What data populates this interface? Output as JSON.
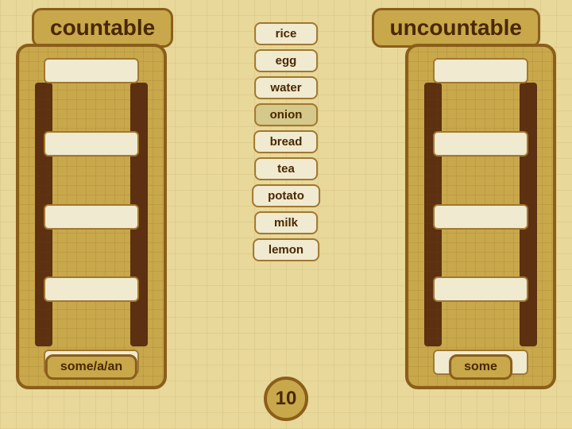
{
  "header": {
    "left_label": "countable",
    "right_label": "uncountable"
  },
  "left_ladder": {
    "rungs": 5,
    "bottom_label": "some/a/an"
  },
  "right_ladder": {
    "rungs": 5,
    "bottom_label": "some"
  },
  "words": [
    {
      "id": "rice",
      "label": "rice"
    },
    {
      "id": "egg",
      "label": "egg"
    },
    {
      "id": "water",
      "label": "water"
    },
    {
      "id": "onion",
      "label": "onion"
    },
    {
      "id": "bread",
      "label": "bread"
    },
    {
      "id": "tea",
      "label": "tea"
    },
    {
      "id": "potato",
      "label": "potato"
    },
    {
      "id": "milk",
      "label": "milk"
    },
    {
      "id": "lemon",
      "label": "lemon"
    }
  ],
  "score": {
    "value": "10"
  }
}
